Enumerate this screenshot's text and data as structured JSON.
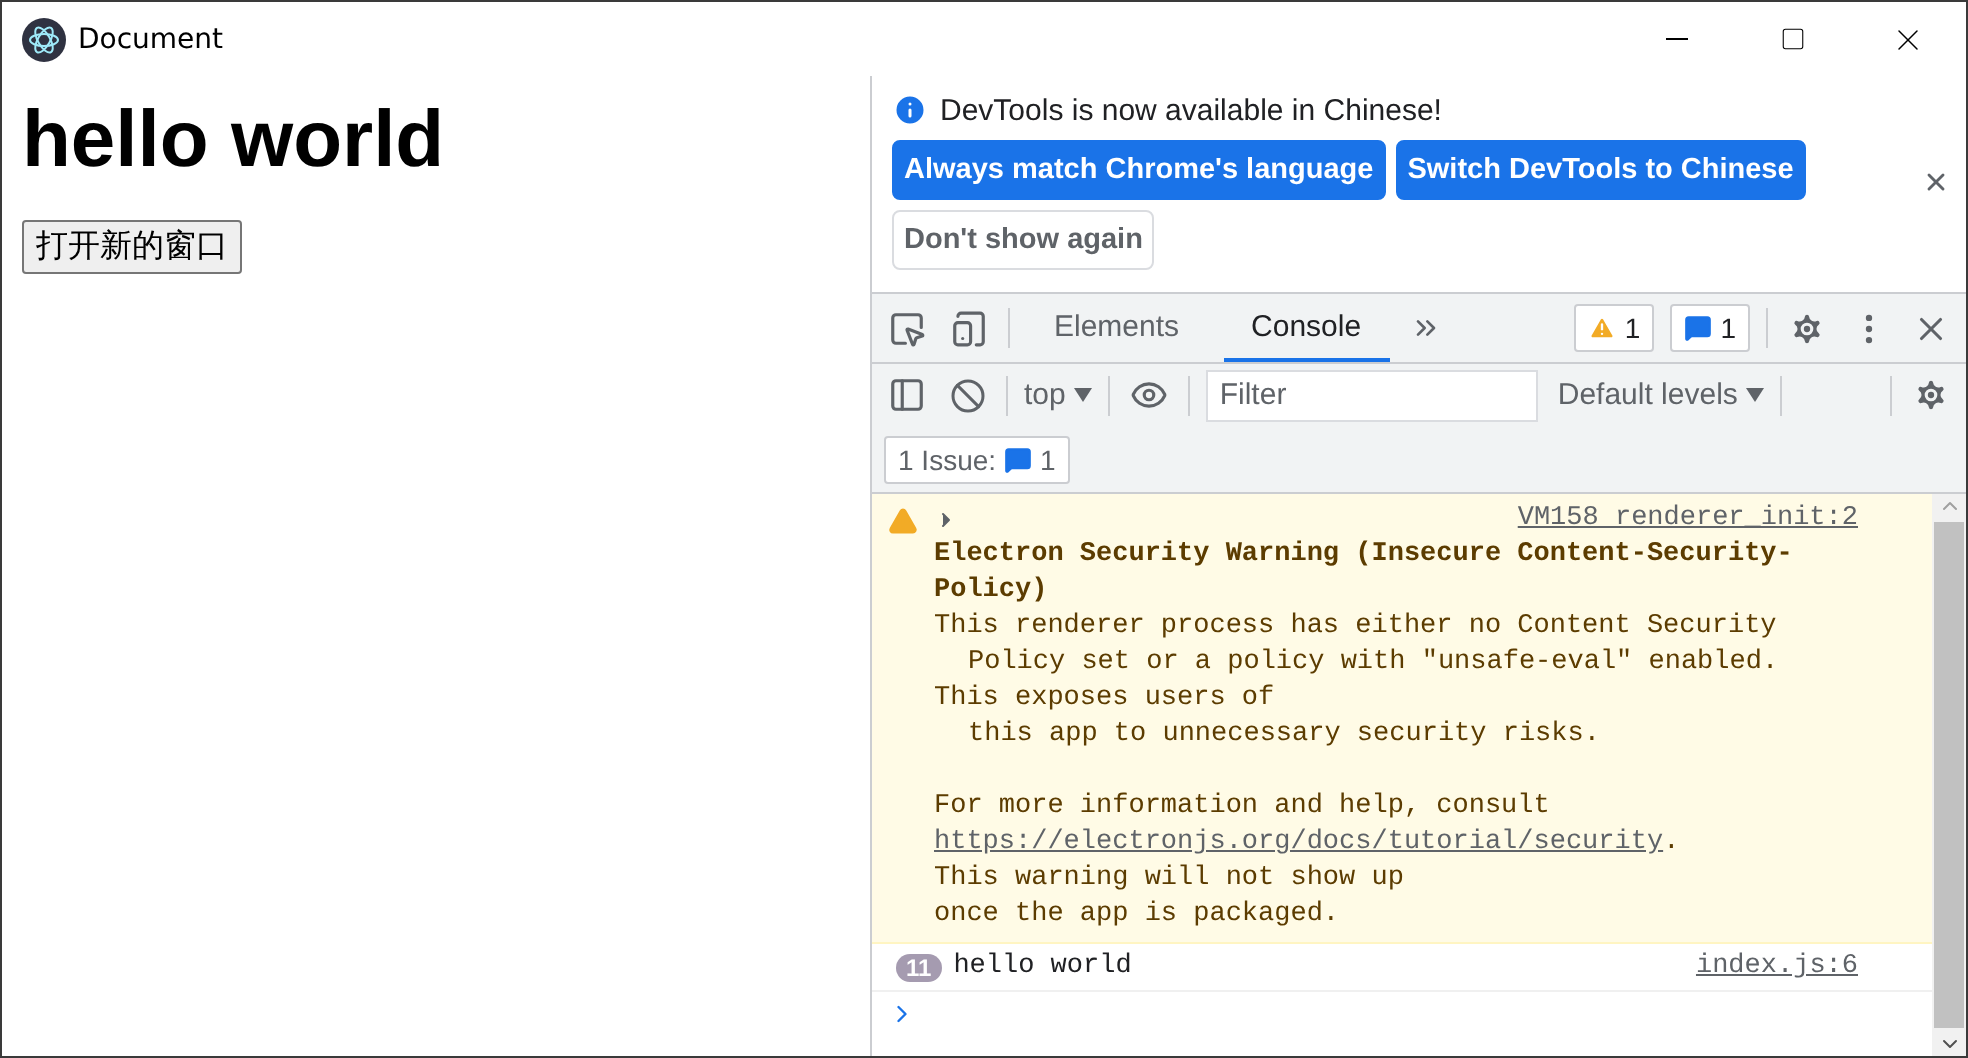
{
  "window": {
    "title": "Document"
  },
  "page": {
    "heading": "hello world",
    "button": "打开新的窗口"
  },
  "devtools": {
    "infobar": {
      "message": "DevTools is now available in Chinese!",
      "buttons": [
        {
          "label": "Always match Chrome's language",
          "kind": "primary"
        },
        {
          "label": "Switch DevTools to Chinese",
          "kind": "primary"
        },
        {
          "label": "Don't show again",
          "kind": "secondary"
        }
      ]
    },
    "tabs": [
      {
        "label": "Elements",
        "selected": false
      },
      {
        "label": "Console",
        "selected": true
      }
    ],
    "warnings_count": "1",
    "messages_count": "1",
    "console_toolbar": {
      "context": "top",
      "filter_placeholder": "Filter",
      "levels": "Default levels"
    },
    "issues": {
      "label": "1 Issue:",
      "count": "1"
    },
    "messages": [
      {
        "kind": "warning",
        "source": "VM158 renderer_init:2",
        "title": "Electron Security Warning (Insecure Content-Security-Policy)",
        "paragraphs": [
          [
            {
              "kind": "text",
              "text": "This renderer process has either no Content Security"
            },
            {
              "kind": "indent",
              "text": "Policy set or a policy with \"unsafe-eval\" enabled."
            },
            {
              "kind": "text",
              "text": "This exposes users of"
            },
            {
              "kind": "indent",
              "text": "this app to unnecessary security risks."
            }
          ],
          [
            {
              "kind": "text",
              "text": "For more information and help, consult"
            },
            {
              "kind": "link",
              "text": "https://electronjs.org/docs/tutorial/security",
              "after": "."
            },
            {
              "kind": "text",
              "text": "This warning will not show up"
            },
            {
              "kind": "text",
              "text": "once the app is packaged."
            }
          ]
        ]
      },
      {
        "kind": "log",
        "repeat": "11",
        "text": "hello world",
        "source": "index.js:6"
      }
    ]
  }
}
